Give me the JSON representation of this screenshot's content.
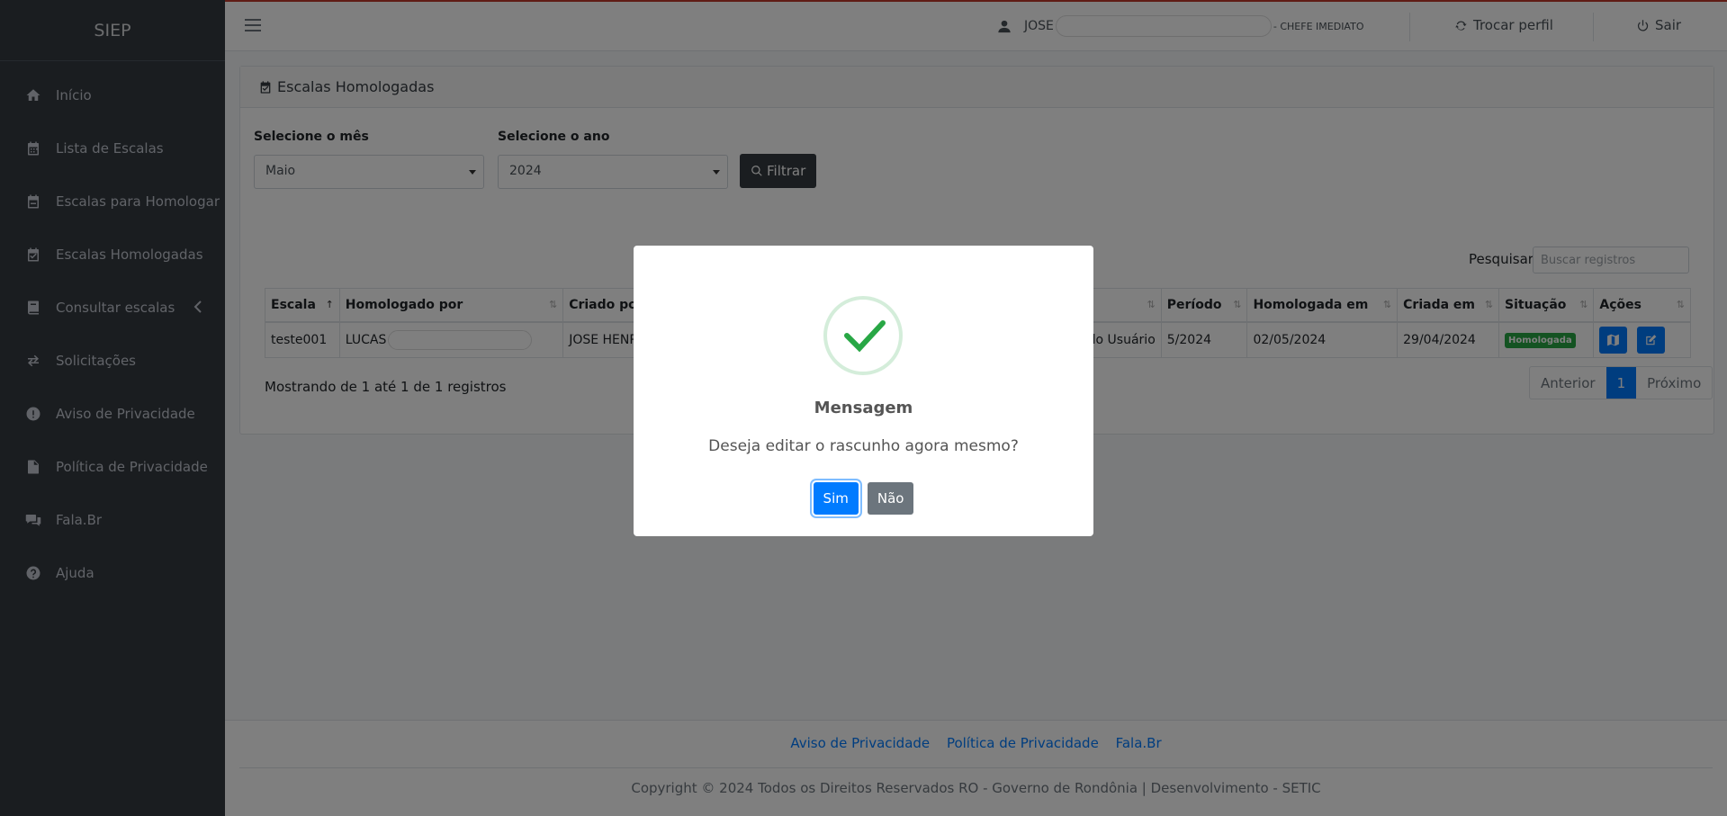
{
  "sidebar": {
    "brand": "SIEP",
    "items": [
      {
        "label": "Início",
        "icon": "home-icon"
      },
      {
        "label": "Lista de Escalas",
        "icon": "calendar-icon"
      },
      {
        "label": "Escalas para Homologar",
        "icon": "calendar-minus-icon"
      },
      {
        "label": "Escalas Homologadas",
        "icon": "calendar-check-icon"
      },
      {
        "label": "Consultar escalas",
        "icon": "book-icon"
      },
      {
        "label": "Solicitações",
        "icon": "exchange-icon"
      },
      {
        "label": "Aviso de Privacidade",
        "icon": "exclamation-circle-icon"
      },
      {
        "label": "Política de Privacidade",
        "icon": "file-icon"
      },
      {
        "label": "Fala.Br",
        "icon": "comments-icon"
      },
      {
        "label": "Ajuda",
        "icon": "question-circle-icon"
      }
    ]
  },
  "topbar": {
    "user_name": "JOSE",
    "role": "- CHEFE IMEDIATO",
    "switch_profile": "Trocar perfil",
    "logout": "Sair"
  },
  "card": {
    "title": "Escalas Homologadas",
    "month_label": "Selecione o mês",
    "month_value": "Maio",
    "year_label": "Selecione o ano",
    "year_value": "2024",
    "filter_button": "Filtrar",
    "search_label": "Pesquisar",
    "search_placeholder": "Buscar registros",
    "table": {
      "headers": [
        "Escala",
        "Homologado por",
        "Criado por",
        "",
        "Período",
        "Homologada em",
        "Criada em",
        "Situação",
        "Ações"
      ],
      "rows": [
        {
          "escala": "teste001",
          "homologado_por": "LUCAS",
          "criado_por": "JOSE HENRIQU",
          "col4": "do Usuário",
          "periodo": "5/2024",
          "homologada_em": "02/05/2024",
          "criada_em": "29/04/2024",
          "situacao": "Homologada"
        }
      ]
    },
    "info": "Mostrando de 1 até 1 de 1 registros",
    "pagination": {
      "prev": "Anterior",
      "current": "1",
      "next": "Próximo"
    }
  },
  "footer": {
    "links": [
      "Aviso de Privacidade",
      "Política de Privacidade",
      "Fala.Br"
    ],
    "copyright": "Copyright © 2024 Todos os Direitos Reservados RO - Governo de Rondônia | Desenvolvimento - SETIC"
  },
  "modal": {
    "title": "Mensagem",
    "text": "Deseja editar o rascunho agora mesmo?",
    "confirm": "Sim",
    "cancel": "Não"
  },
  "colors": {
    "sidebar_bg": "#343a40",
    "primary": "#007bff",
    "success": "#28a745",
    "dark_button": "#343a40",
    "secondary": "#6c757d"
  }
}
